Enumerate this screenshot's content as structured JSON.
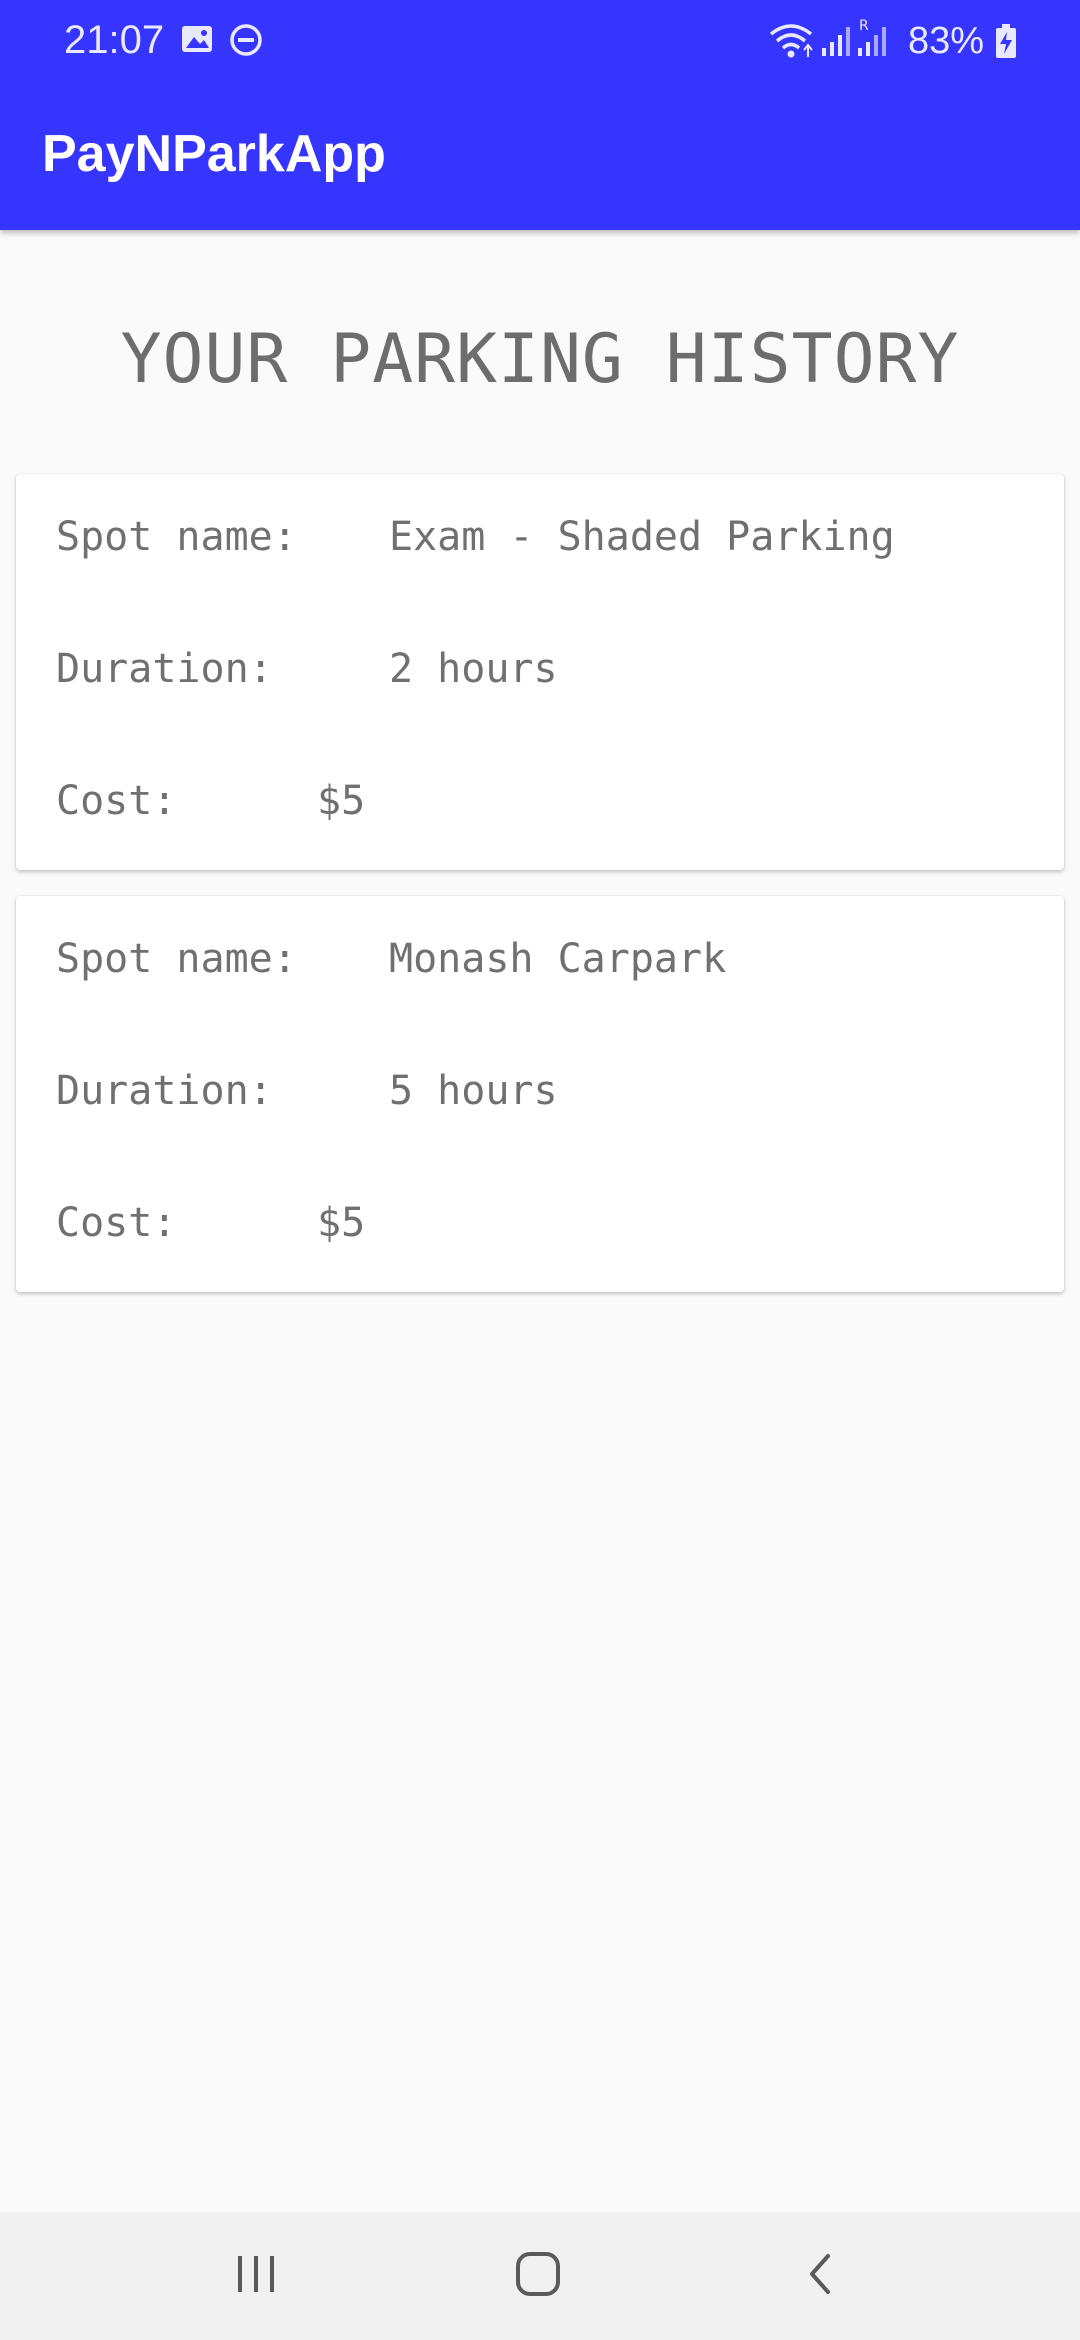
{
  "status_bar": {
    "time": "21:07",
    "battery": "83%",
    "icons": [
      "image-icon",
      "do-not-disturb-icon",
      "wifi-icon",
      "signal-icon",
      "signal-roaming-icon",
      "battery-charging-icon"
    ]
  },
  "app_bar": {
    "title": "PayNParkApp"
  },
  "page": {
    "heading": "YOUR PARKING HISTORY"
  },
  "history": [
    {
      "spot_label": "Spot name:",
      "spot_value": "Exam - Shaded Parking",
      "duration_label": "Duration:",
      "duration_value": "2 hours",
      "cost_label": "Cost:",
      "cost_value": "$5"
    },
    {
      "spot_label": "Spot name:",
      "spot_value": "Monash Carpark",
      "duration_label": "Duration:",
      "duration_value": "5 hours",
      "cost_label": "Cost:",
      "cost_value": "$5"
    }
  ],
  "nav_bar": {
    "buttons": [
      "recent-apps-icon",
      "home-icon",
      "back-icon"
    ]
  },
  "colors": {
    "app_bar": "#3535ff",
    "background": "#fafafa",
    "text_muted": "#707070"
  }
}
